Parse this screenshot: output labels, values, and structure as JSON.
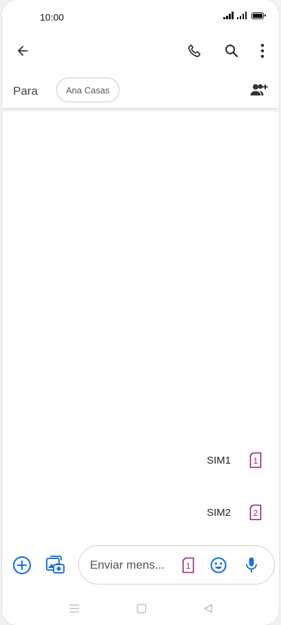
{
  "status_bar": {
    "time": "10:00"
  },
  "recipients": {
    "label": "Para",
    "chips": [
      "Ana Casas"
    ]
  },
  "sim_options": [
    {
      "label": "SIM1",
      "badge": "1"
    },
    {
      "label": "SIM2",
      "badge": "2"
    }
  ],
  "compose": {
    "placeholder": "Enviar mens...",
    "sim_badge": "1"
  },
  "icons": {
    "back": "arrow-left-icon",
    "call": "phone-icon",
    "search": "search-icon",
    "more": "more-vert-icon",
    "add_person": "person-add-icon",
    "plus": "add-circle-icon",
    "media": "gallery-icon",
    "emoji": "emoji-icon",
    "mic": "microphone-icon"
  },
  "colors": {
    "accent": "#1a73e8",
    "sim": "#8e1e6e"
  }
}
